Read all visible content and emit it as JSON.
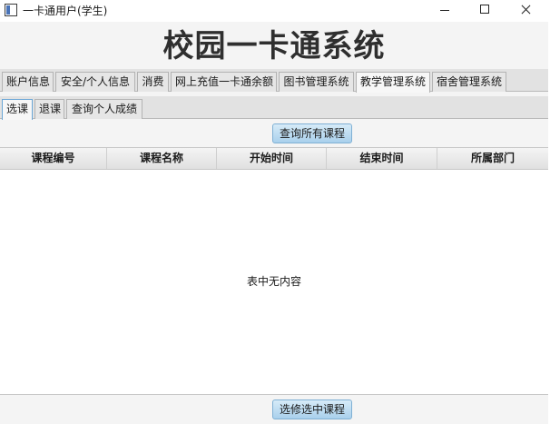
{
  "window": {
    "title": "一卡通用户(学生)"
  },
  "header": {
    "title": "校园一卡通系统"
  },
  "main_tabs": [
    {
      "label": "账户信息"
    },
    {
      "label": "安全/个人信息"
    },
    {
      "label": "消费"
    },
    {
      "label": "网上充值一卡通余额"
    },
    {
      "label": "图书管理系统"
    },
    {
      "label": "教学管理系统"
    },
    {
      "label": "宿舍管理系统"
    }
  ],
  "main_tabs_active": "教学管理系统",
  "sub_tabs": [
    {
      "label": "选课"
    },
    {
      "label": "退课"
    },
    {
      "label": "查询个人成绩"
    }
  ],
  "sub_tabs_active": "选课",
  "toolbar": {
    "query_button_label": "查询所有课程"
  },
  "table": {
    "columns": [
      "课程编号",
      "课程名称",
      "开始时间",
      "结束时间",
      "所属部门"
    ],
    "rows": [],
    "empty_text": "表中无内容"
  },
  "footer": {
    "select_button_label": "选修选中课程"
  },
  "icons": {
    "app": "window-app-icon",
    "minimize": "minimize-icon",
    "maximize": "maximize-icon",
    "close": "close-icon"
  },
  "colors": {
    "button_fill": "#a9d0ec",
    "button_border": "#7fb0d4",
    "active_tab_border": "#6aa6d6"
  }
}
